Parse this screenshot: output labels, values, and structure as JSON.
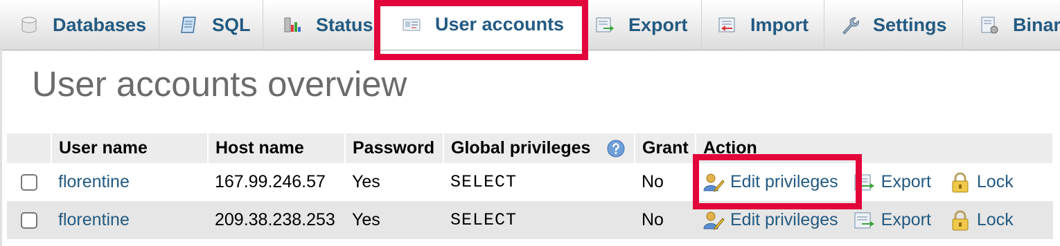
{
  "tabs": [
    {
      "label": "Databases",
      "icon": "database-icon"
    },
    {
      "label": "SQL",
      "icon": "sql-scroll-icon"
    },
    {
      "label": "Status",
      "icon": "status-chart-icon"
    },
    {
      "label": "User accounts",
      "icon": "user-card-icon",
      "active": true
    },
    {
      "label": "Export",
      "icon": "export-icon"
    },
    {
      "label": "Import",
      "icon": "import-icon"
    },
    {
      "label": "Settings",
      "icon": "wrench-icon"
    },
    {
      "label": "Binar",
      "icon": "binary-log-icon"
    }
  ],
  "page": {
    "title": "User accounts overview"
  },
  "table": {
    "headers": {
      "user": "User name",
      "host": "Host name",
      "password": "Password",
      "privileges": "Global privileges",
      "grant": "Grant",
      "action": "Action"
    },
    "rows": [
      {
        "user": "florentine",
        "host": "167.99.246.57",
        "password": "Yes",
        "privileges": "SELECT",
        "grant": "No",
        "edit": "Edit privileges",
        "export": "Export",
        "lock": "Lock"
      },
      {
        "user": "florentine",
        "host": "209.38.238.253",
        "password": "Yes",
        "privileges": "SELECT",
        "grant": "No",
        "edit": "Edit privileges",
        "export": "Export",
        "lock": "Lock"
      }
    ]
  },
  "colors": {
    "link": "#235a81",
    "highlight": "#e2063a",
    "title": "#6b6b6b"
  }
}
